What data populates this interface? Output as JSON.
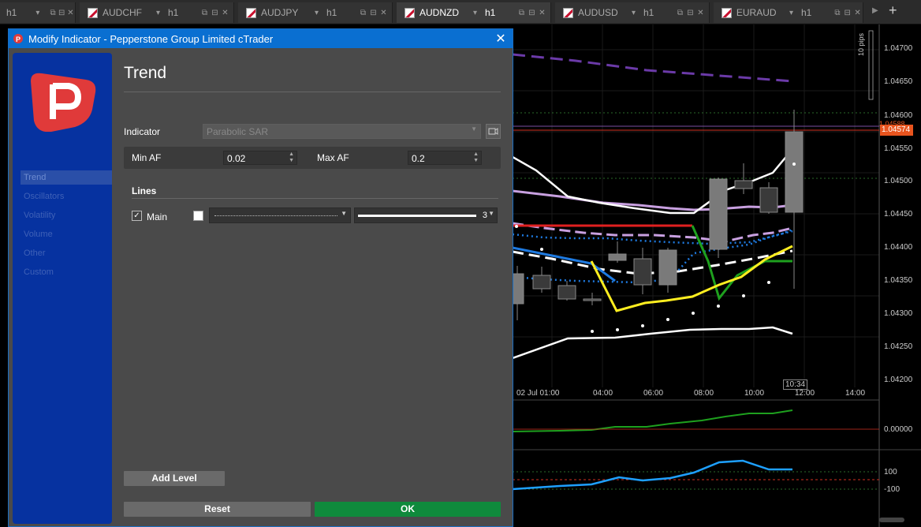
{
  "tabs": [
    {
      "symbol": "h1",
      "timeframe": "",
      "active": false
    },
    {
      "symbol": "AUDCHF",
      "timeframe": "h1",
      "active": false
    },
    {
      "symbol": "AUDJPY",
      "timeframe": "h1",
      "active": false
    },
    {
      "symbol": "AUDNZD",
      "timeframe": "h1",
      "active": true
    },
    {
      "symbol": "AUDUSD",
      "timeframe": "h1",
      "active": false
    },
    {
      "symbol": "EURAUD",
      "timeframe": "h1",
      "active": false
    }
  ],
  "dialog": {
    "title": "Modify Indicator - Pepperstone Group Limited cTrader",
    "heading": "Trend",
    "nav": [
      "Trend",
      "Oscillators",
      "Volatility",
      "Volume",
      "Other",
      "Custom"
    ],
    "indicator_label": "Indicator",
    "indicator_value": "Parabolic SAR",
    "min_af_label": "Min AF",
    "min_af_value": "0.02",
    "max_af_label": "Max AF",
    "max_af_value": "0.2",
    "lines_label": "Lines",
    "main_label": "Main",
    "main_checked": true,
    "thickness": "3",
    "add_level": "Add Level",
    "reset": "Reset",
    "ok": "OK"
  },
  "chart": {
    "price_labels": [
      "1.04700",
      "1.04650",
      "1.04600",
      "1.04550",
      "1.04500",
      "1.04450",
      "1.04400",
      "1.04350",
      "1.04300",
      "1.04250",
      "1.04200"
    ],
    "current_price": "1.04574",
    "hidden_price": "1.04588",
    "pips_label": "10 pips",
    "time_labels": [
      "02 Jul 01:00",
      "04:00",
      "06:00",
      "08:00",
      "10:00",
      "12:00",
      "14:00"
    ],
    "cursor_time": "10:34",
    "osc1_value": "0.00000",
    "osc2_levels": [
      "100",
      "-100"
    ],
    "colors": {
      "bull": "#7a7a7a",
      "bear": "#3a3a3a",
      "price_tag": "#e8541e",
      "accent": "#0a6fd1",
      "ok": "#0f8a3c"
    }
  }
}
